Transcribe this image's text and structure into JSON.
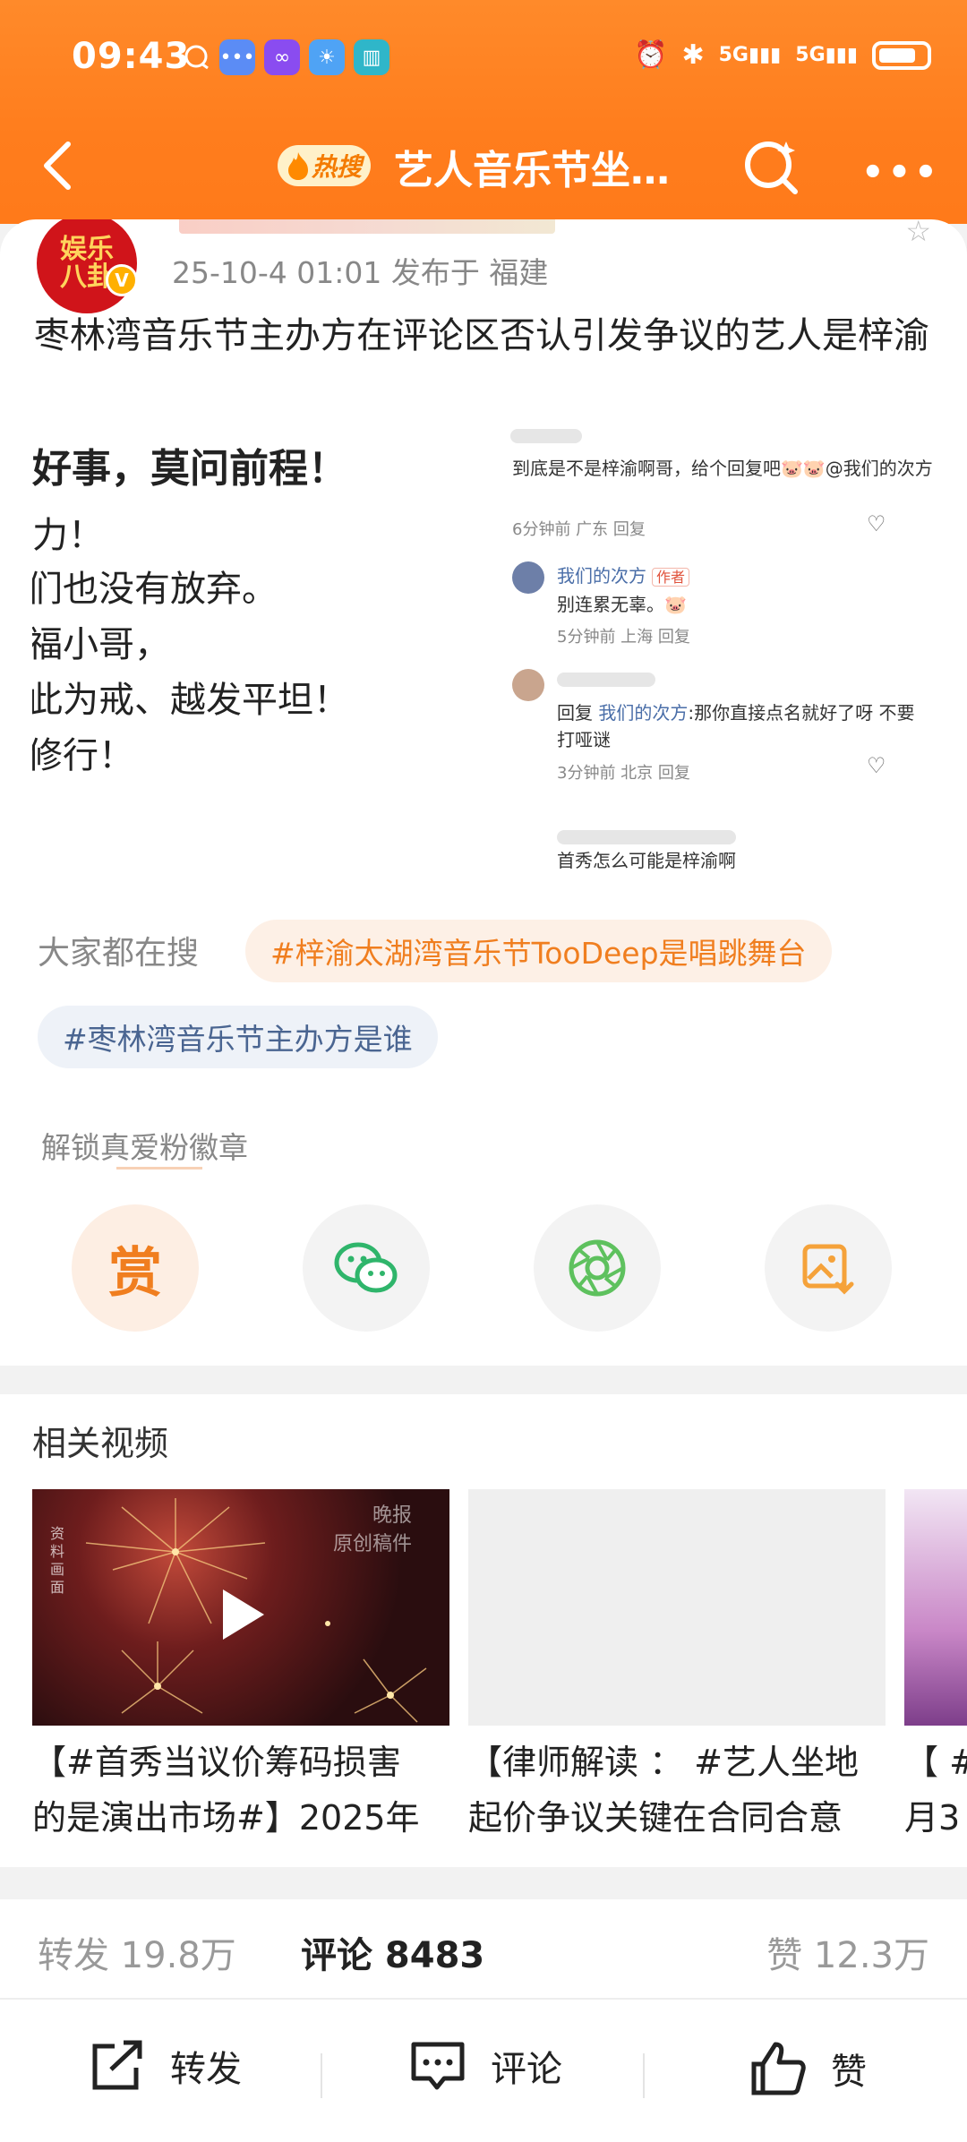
{
  "status_bar": {
    "time": "09:43",
    "network": "5G",
    "network2": "5G"
  },
  "navbar": {
    "hot_badge": "热搜",
    "title": "艺人音乐节坐…",
    "more": "•••"
  },
  "post": {
    "avatar_text": "娱乐八卦",
    "meta": "25-10-4 01:01  发布于 福建",
    "text": "枣林湾音乐节主办方在评论区否认引发争议的艺人是梓渝"
  },
  "image_left": {
    "lines": [
      "好事，莫问前程！",
      "力！",
      "们也没有放弃。",
      "福小哥，",
      "此为戒、越发平坦！",
      "修行！"
    ]
  },
  "image_right": {
    "c1_text": "到底是不是梓渝啊哥，给个回复吧🐷🐷@我们的次方",
    "c1_meta": "6分钟前 广东   回复",
    "c2_name": "我们的次方",
    "c2_tag": "作者",
    "c2_text": "别连累无辜。🐷",
    "c2_meta": "5分钟前 上海   回复",
    "c3_text_prefix": "回复",
    "c3_reply_to": "我们的次方",
    "c3_text": ":那你直接点名就好了呀 不要打哑谜",
    "c3_meta": "3分钟前 北京   回复",
    "c4_text": "首秀怎么可能是梓渝啊"
  },
  "search": {
    "label": "大家都在搜",
    "chip1": "#梓渝太湖湾音乐节TooDeep是唱跳舞台",
    "chip2": "#枣林湾音乐节主办方是谁"
  },
  "fan": {
    "label": "解锁真爱粉徽章",
    "reward": "赏"
  },
  "videos": {
    "title": "相关视频",
    "items": [
      {
        "line1": "【#首秀当议价筹码损害",
        "line2": "的是演出市场#】2025年",
        "watermark": "晚报\n原创稿件",
        "tag": "资料画面"
      },
      {
        "line1": "【律师解读 ： #艺人坐地",
        "line2": "起价争议关键在合同合意"
      },
      {
        "line1": "【 #",
        "line2": "月3"
      }
    ]
  },
  "stats": {
    "forward": "转发 19.8万",
    "comment": "评论 8483",
    "like": "赞 12.3万"
  },
  "bottom": {
    "forward": "转发",
    "comment": "评论",
    "like": "赞"
  },
  "colors": {
    "accent": "#ff7d1d",
    "hot_chip": "#f07e1f",
    "blue_chip": "#4a6591"
  }
}
